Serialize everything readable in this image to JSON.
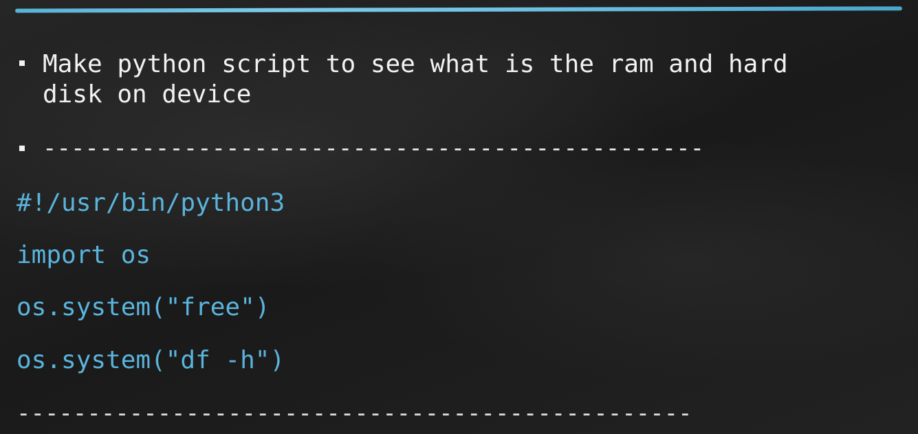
{
  "accent_color": "#5ab4dc",
  "bullets": [
    {
      "text": "Make python script to see what is the ram and hard\ndisk on device"
    },
    {
      "text": "-----------------------------------------------"
    }
  ],
  "code_lines": [
    "#!/usr/bin/python3",
    "import os",
    "os.system(\"free\")",
    "os.system(\"df -h\")"
  ],
  "separator": "------------------------------------------------"
}
